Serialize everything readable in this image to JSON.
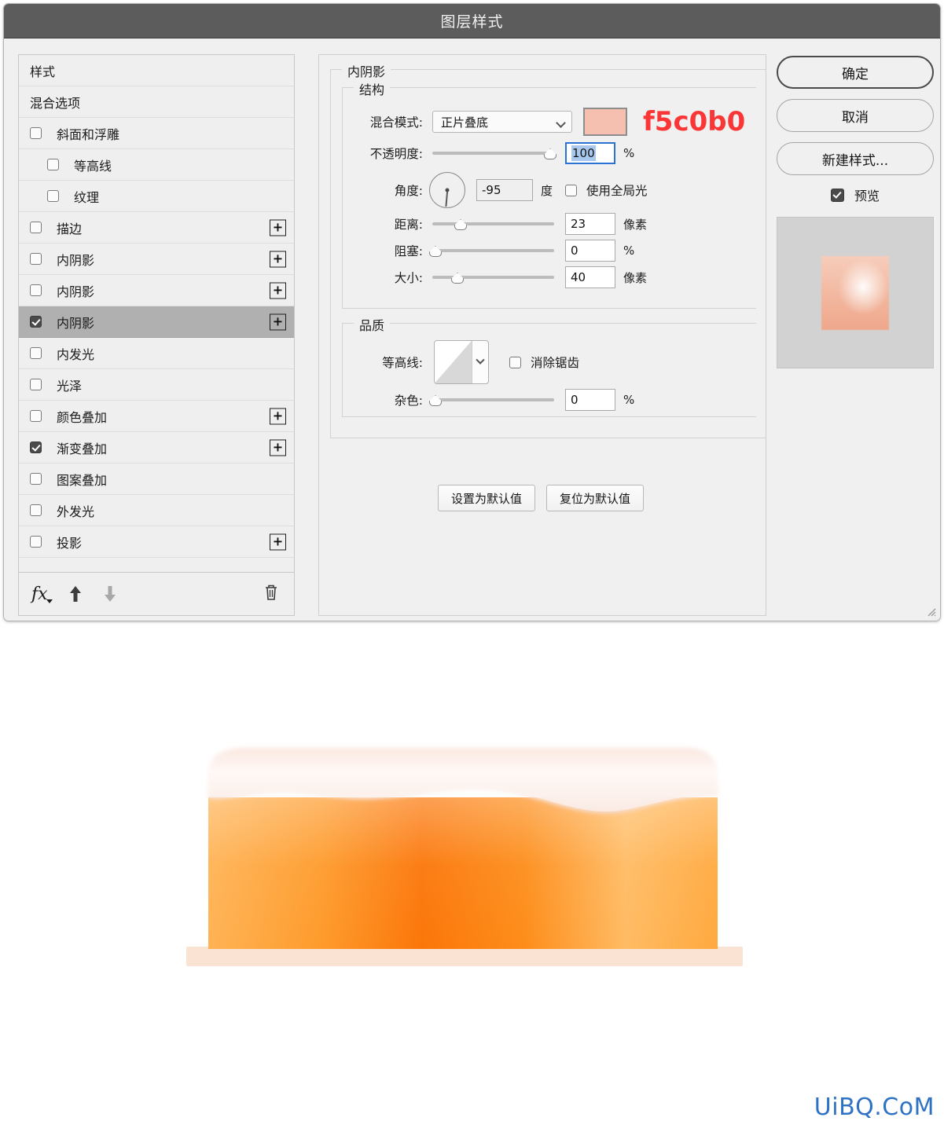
{
  "window": {
    "title": "图层样式"
  },
  "sidebar": {
    "items": [
      {
        "label": "样式",
        "type": "plain",
        "checkbox": false,
        "checked": false,
        "plus": false,
        "indent": false,
        "selected": false
      },
      {
        "label": "混合选项",
        "type": "plain",
        "checkbox": false,
        "checked": false,
        "plus": false,
        "indent": false,
        "selected": false
      },
      {
        "label": "斜面和浮雕",
        "type": "check",
        "checkbox": true,
        "checked": false,
        "plus": false,
        "indent": false,
        "selected": false
      },
      {
        "label": "等高线",
        "type": "check",
        "checkbox": true,
        "checked": false,
        "plus": false,
        "indent": true,
        "selected": false
      },
      {
        "label": "纹理",
        "type": "check",
        "checkbox": true,
        "checked": false,
        "plus": false,
        "indent": true,
        "selected": false
      },
      {
        "label": "描边",
        "type": "check",
        "checkbox": true,
        "checked": false,
        "plus": true,
        "indent": false,
        "selected": false
      },
      {
        "label": "内阴影",
        "type": "check",
        "checkbox": true,
        "checked": false,
        "plus": true,
        "indent": false,
        "selected": false
      },
      {
        "label": "内阴影",
        "type": "check",
        "checkbox": true,
        "checked": false,
        "plus": true,
        "indent": false,
        "selected": false
      },
      {
        "label": "内阴影",
        "type": "check",
        "checkbox": true,
        "checked": true,
        "plus": true,
        "indent": false,
        "selected": true
      },
      {
        "label": "内发光",
        "type": "check",
        "checkbox": true,
        "checked": false,
        "plus": false,
        "indent": false,
        "selected": false
      },
      {
        "label": "光泽",
        "type": "check",
        "checkbox": true,
        "checked": false,
        "plus": false,
        "indent": false,
        "selected": false
      },
      {
        "label": "颜色叠加",
        "type": "check",
        "checkbox": true,
        "checked": false,
        "plus": true,
        "indent": false,
        "selected": false
      },
      {
        "label": "渐变叠加",
        "type": "check",
        "checkbox": true,
        "checked": true,
        "plus": true,
        "indent": false,
        "selected": false
      },
      {
        "label": "图案叠加",
        "type": "check",
        "checkbox": true,
        "checked": false,
        "plus": false,
        "indent": false,
        "selected": false
      },
      {
        "label": "外发光",
        "type": "check",
        "checkbox": true,
        "checked": false,
        "plus": false,
        "indent": false,
        "selected": false
      },
      {
        "label": "投影",
        "type": "check",
        "checkbox": true,
        "checked": false,
        "plus": true,
        "indent": false,
        "selected": false
      }
    ],
    "plus_label": "+",
    "toolbar": {
      "fx_label": "fx",
      "move_up_icon": "arrow-up-icon",
      "move_down_icon": "arrow-down-icon",
      "delete_icon": "trash-icon"
    }
  },
  "main": {
    "panel_title": "内阴影",
    "structure": {
      "title": "结构",
      "blend_mode_label": "混合模式:",
      "blend_mode_value": "正片叠底",
      "color_hex": "#f5c0b0",
      "hex_annotation": "f5c0b0",
      "annotation_color": "#fa3636",
      "opacity_label": "不透明度:",
      "opacity_value": "100",
      "opacity_unit": "%",
      "angle_label": "角度:",
      "angle_value": "-95",
      "angle_unit": "度",
      "global_light_label": "使用全局光",
      "global_light_checked": false,
      "distance_label": "距离:",
      "distance_value": "23",
      "distance_unit": "像素",
      "choke_label": "阻塞:",
      "choke_value": "0",
      "choke_unit": "%",
      "size_label": "大小:",
      "size_value": "40",
      "size_unit": "像素"
    },
    "quality": {
      "title": "品质",
      "contour_label": "等高线:",
      "antialias_label": "消除锯齿",
      "antialias_checked": false,
      "noise_label": "杂色:",
      "noise_value": "0",
      "noise_unit": "%"
    },
    "set_default_label": "设置为默认值",
    "reset_default_label": "复位为默认值"
  },
  "right": {
    "ok_label": "确定",
    "cancel_label": "取消",
    "new_style_label": "新建样式...",
    "preview_label": "预览",
    "preview_checked": true
  },
  "artwork": {
    "description": "orange-glass-with-cream-top",
    "body_color_dark": "#f97a10",
    "body_color_light": "#ffc266",
    "cream_color": "#fdf3ef",
    "base_color": "#fbe3d4"
  },
  "watermark": {
    "text": "UiBQ.CoM",
    "color": "#2f72c4"
  }
}
